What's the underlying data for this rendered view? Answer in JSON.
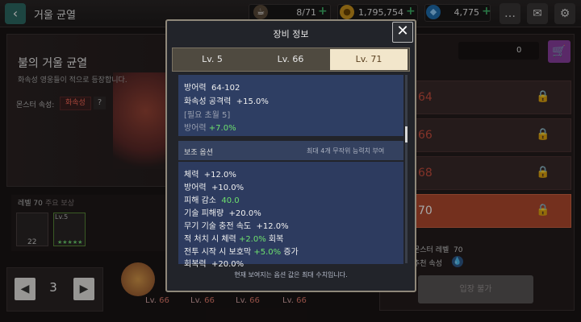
{
  "topbar": {
    "back_icon": "back-arrow-icon",
    "title": "거울 균열",
    "stamina": "8/71",
    "gold": "1,795,754",
    "gems": "4,775"
  },
  "left": {
    "dungeon_name": "불의 거울 균열",
    "dungeon_desc": "화속성 영웅들이 적으로 등장합니다.",
    "attr_label": "몬스터 속성:",
    "attr_value": "화속성",
    "help": "?",
    "level_label": "레벨 70",
    "reward_label": "주요 보상",
    "reward_count": "22",
    "reward_lv": "Lv.5",
    "stars": "★★★★★",
    "stepper_value": "3"
  },
  "heroes": [
    {
      "label": "Lv.",
      "level": "66"
    },
    {
      "label": "Lv.",
      "level": "66"
    },
    {
      "label": "Lv.",
      "level": "66"
    },
    {
      "label": "Lv.",
      "level": "66"
    }
  ],
  "right": {
    "gem_count": "0",
    "stages": [
      "64",
      "66",
      "68",
      "70"
    ],
    "monster_level_label": "몬스터 레벨",
    "monster_level": "70",
    "recommend_attr": "추천 속성",
    "enter_label": "입장 불가"
  },
  "modal": {
    "title": "장비 정보",
    "tabs": [
      "Lv. 5",
      "Lv. 66",
      "Lv. 71"
    ],
    "active_tab": 2,
    "main_stats": {
      "defense": "방어력",
      "defense_val": "64-102",
      "fire_attack": "화속성 공격력",
      "fire_attack_val": "+15.0%",
      "req": "[필요 초월 5]",
      "req_stat": "방어력",
      "req_stat_val": "+7.0%"
    },
    "sub_title": "보조 옵션",
    "sub_note": "최대 4개 무작위 능력치 부여",
    "options": [
      {
        "name": "체력",
        "val": "+12.0%"
      },
      {
        "name": "방어력",
        "val": "+10.0%"
      },
      {
        "name": "피해 감소",
        "val": "40.0"
      },
      {
        "name": "기술 피해량",
        "val": "+20.0%"
      },
      {
        "name": "무기 기술 충전 속도",
        "val": "+12.0%"
      },
      {
        "name": "적 처치 시 체력",
        "val": "+2.0%",
        "suffix": "회복"
      },
      {
        "name": "전투 시작 시 보호막",
        "val": "+5.0%",
        "suffix": "증가"
      },
      {
        "name": "회복력",
        "val": "+20.0%"
      }
    ],
    "footer": "현재 보여지는 옵션 값은 최대 수치입니다.",
    "close_icon": "close-icon"
  },
  "colors": {
    "accent_green": "#6ee16e",
    "tab_active": "#f2e6cb",
    "fire": "#ff6b5a"
  }
}
